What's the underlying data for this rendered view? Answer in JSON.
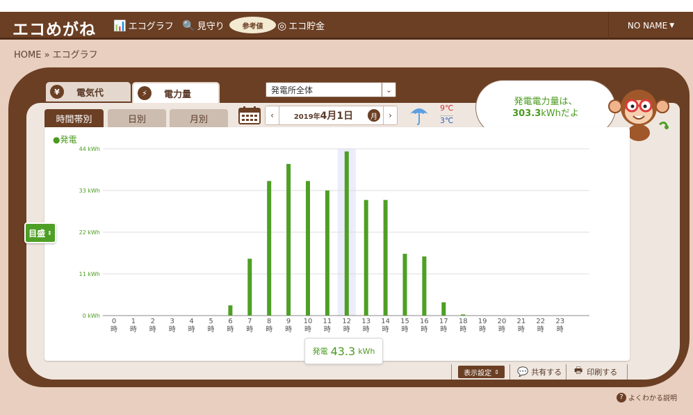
{
  "header": {
    "logo": "エコめがね",
    "nav": [
      {
        "label": "エコグラフ",
        "icon": "bar-chart-icon"
      },
      {
        "label": "見守り",
        "icon": "magnifier-icon"
      },
      {
        "label": "エコ貯金",
        "icon": "coin-icon"
      }
    ],
    "badge": "参考値",
    "user": "NO NAME"
  },
  "breadcrumb": "HOME » エコグラフ",
  "tabs": {
    "cost": {
      "label": "電気代",
      "icon": "yen-icon"
    },
    "power": {
      "label": "電力量",
      "icon": "bolt-icon"
    }
  },
  "plant_select": {
    "value": "発電所全体"
  },
  "subtabs": [
    "時間帯別",
    "日別",
    "月別"
  ],
  "date": {
    "year": "2019",
    "year_suffix": "年",
    "month_day": "4月1日",
    "badge": "月"
  },
  "weather": {
    "icon": "umbrella-icon",
    "high": "9℃",
    "low": "3℃"
  },
  "bubble": {
    "line1": "発電電力量は、",
    "value": "303.3",
    "unit": "kWhだよ"
  },
  "legend": "●発電",
  "memori_button": "目盛",
  "tooltip": {
    "label": "発電",
    "value": "43.3",
    "unit": "kWh"
  },
  "actions": {
    "display_settings": "表示設定",
    "share": "共有する",
    "print": "印刷する"
  },
  "help": "よくわかる説明",
  "colors": {
    "brand_brown": "#6b3f24",
    "bar_green": "#4e9f25",
    "highlight": "#ececfa"
  },
  "chart_data": {
    "type": "bar",
    "series": [
      {
        "name": "発電",
        "values": [
          0,
          0,
          0,
          0,
          0,
          0,
          2.7,
          15,
          35.5,
          40,
          35.5,
          33,
          43.3,
          30.5,
          30.5,
          16.3,
          15.6,
          3.5,
          0.3,
          0,
          0,
          0,
          0,
          0
        ]
      }
    ],
    "categories": [
      "0",
      "1",
      "2",
      "3",
      "4",
      "5",
      "6",
      "7",
      "8",
      "9",
      "10",
      "11",
      "12",
      "13",
      "14",
      "15",
      "16",
      "17",
      "18",
      "19",
      "20",
      "21",
      "22",
      "23"
    ],
    "category_suffix": "時",
    "yticks": [
      "0 kWh",
      "11 kWh",
      "22 kWh",
      "33 kWh",
      "44 kWh"
    ],
    "ylim": [
      0,
      44
    ],
    "highlight_index": 12
  }
}
